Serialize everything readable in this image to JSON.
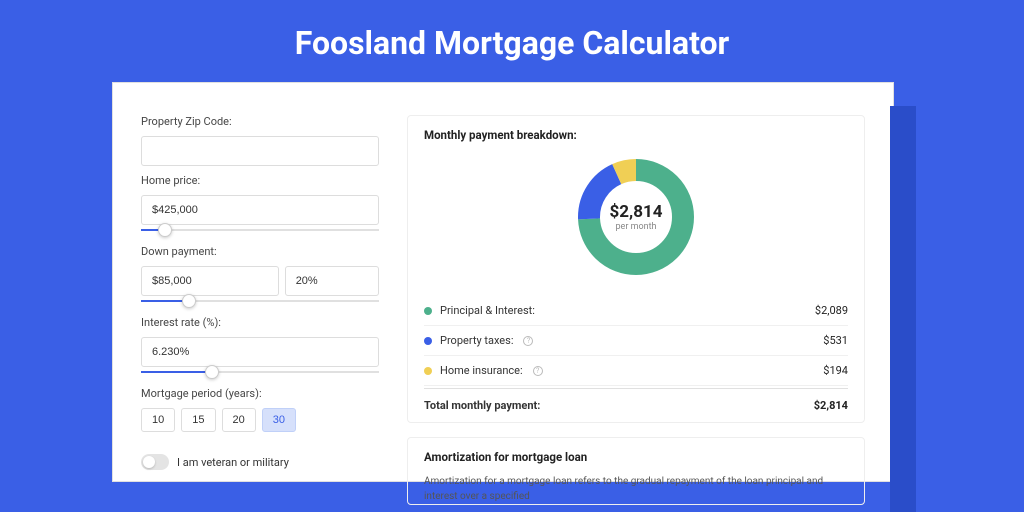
{
  "title": "Foosland Mortgage Calculator",
  "form": {
    "zip": {
      "label": "Property Zip Code:",
      "value": ""
    },
    "home_price": {
      "label": "Home price:",
      "value": "$425,000",
      "slider_pct": 10
    },
    "down_payment": {
      "label": "Down payment:",
      "amount": "$85,000",
      "percent": "20%",
      "slider_pct": 20
    },
    "interest": {
      "label": "Interest rate (%):",
      "value": "6.230%",
      "slider_pct": 30
    },
    "period": {
      "label": "Mortgage period (years):",
      "options": [
        "10",
        "15",
        "20",
        "30"
      ],
      "active": "30"
    },
    "veteran": {
      "label": "I am veteran or military",
      "checked": false
    }
  },
  "breakdown": {
    "title": "Monthly payment breakdown:",
    "center_amount": "$2,814",
    "center_sub": "per month",
    "items": [
      {
        "label": "Principal & Interest:",
        "value": "$2,089",
        "color": "#4db08c"
      },
      {
        "label": "Property taxes:",
        "value": "$531",
        "color": "#3a5fe6",
        "info": true
      },
      {
        "label": "Home insurance:",
        "value": "$194",
        "color": "#f0cf55",
        "info": true
      }
    ],
    "total": {
      "label": "Total monthly payment:",
      "value": "$2,814"
    }
  },
  "amortization": {
    "title": "Amortization for mortgage loan",
    "text": "Amortization for a mortgage loan refers to the gradual repayment of the loan principal and interest over a specified"
  },
  "chart_data": {
    "type": "pie",
    "title": "Monthly payment breakdown",
    "series": [
      {
        "name": "Principal & Interest",
        "value": 2089,
        "pct": 74.2,
        "color": "#4db08c"
      },
      {
        "name": "Property taxes",
        "value": 531,
        "pct": 18.9,
        "color": "#3a5fe6"
      },
      {
        "name": "Home insurance",
        "value": 194,
        "pct": 6.9,
        "color": "#f0cf55"
      }
    ],
    "total": 2814,
    "center_label": "$2,814 per month"
  }
}
